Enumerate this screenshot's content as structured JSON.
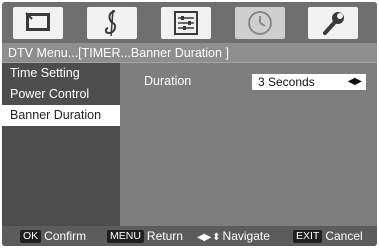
{
  "icons": [
    {
      "name": "tv-picture-icon",
      "active": false
    },
    {
      "name": "music-note-icon",
      "active": false
    },
    {
      "name": "settings-sliders-icon",
      "active": false
    },
    {
      "name": "clock-icon",
      "active": true
    },
    {
      "name": "wrench-icon",
      "active": false
    }
  ],
  "breadcrumb": "DTV Menu...[TIMER...Banner Duration ]",
  "sidebar": {
    "items": [
      {
        "label": "Time Setting"
      },
      {
        "label": "Power Control"
      },
      {
        "label": "Banner Duration"
      }
    ],
    "selected_index": 2
  },
  "setting": {
    "label": "Duration",
    "value": "3 Seconds",
    "arrows": "◀▶"
  },
  "footer": {
    "ok": {
      "key": "OK",
      "label": "Confirm"
    },
    "menu": {
      "key": "MENU",
      "label": "Return"
    },
    "navigate": {
      "arrows": "◀▶ ⬍",
      "label": "Navigate"
    },
    "exit": {
      "key": "EXIT",
      "label": "Cancel"
    }
  },
  "colors": {
    "panel": "#7a7a7a",
    "sidebar": "#4d4d4d",
    "selected_bg": "#ffffff",
    "footer": "#5c5c5c"
  }
}
